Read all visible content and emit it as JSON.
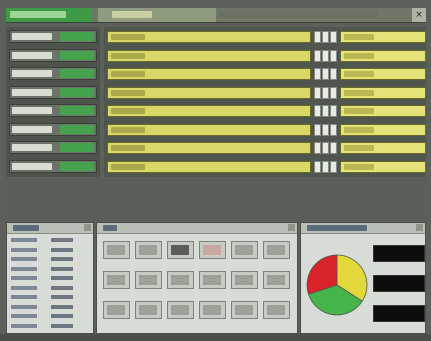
{
  "window": {
    "title": "",
    "tab": ""
  },
  "devices": [
    {
      "name": "",
      "state": ""
    },
    {
      "name": "",
      "state": ""
    },
    {
      "name": "",
      "state": ""
    },
    {
      "name": "",
      "state": ""
    },
    {
      "name": "",
      "state": ""
    },
    {
      "name": "",
      "state": ""
    },
    {
      "name": "",
      "state": ""
    },
    {
      "name": "",
      "state": ""
    }
  ],
  "channels": [
    {
      "label": "",
      "tag": ""
    },
    {
      "label": "",
      "tag": ""
    },
    {
      "label": "",
      "tag": ""
    },
    {
      "label": "",
      "tag": ""
    },
    {
      "label": "",
      "tag": ""
    },
    {
      "label": "",
      "tag": ""
    },
    {
      "label": "",
      "tag": ""
    },
    {
      "label": "",
      "tag": ""
    }
  ],
  "details": {
    "title": "",
    "rows": [
      {
        "key": "",
        "value": ""
      },
      {
        "key": "",
        "value": ""
      },
      {
        "key": "",
        "value": ""
      },
      {
        "key": "",
        "value": ""
      },
      {
        "key": "",
        "value": ""
      },
      {
        "key": "",
        "value": ""
      },
      {
        "key": "",
        "value": ""
      },
      {
        "key": "",
        "value": ""
      },
      {
        "key": "",
        "value": ""
      },
      {
        "key": "",
        "value": ""
      }
    ]
  },
  "thumbnails": {
    "title": "",
    "count": 18
  },
  "status_monitor": {
    "title": "",
    "chart_data": {
      "type": "pie",
      "slices": [
        {
          "label": "",
          "value": 0.34,
          "color": "#e2d83a"
        },
        {
          "label": "",
          "value": 0.36,
          "color": "#45b449"
        },
        {
          "label": "",
          "value": 0.3,
          "color": "#d8232a"
        }
      ]
    }
  },
  "colors": {
    "device_ok": "#45a34d",
    "channel_bar": "#d8d868",
    "panel_bg": "#d8dcd6"
  }
}
